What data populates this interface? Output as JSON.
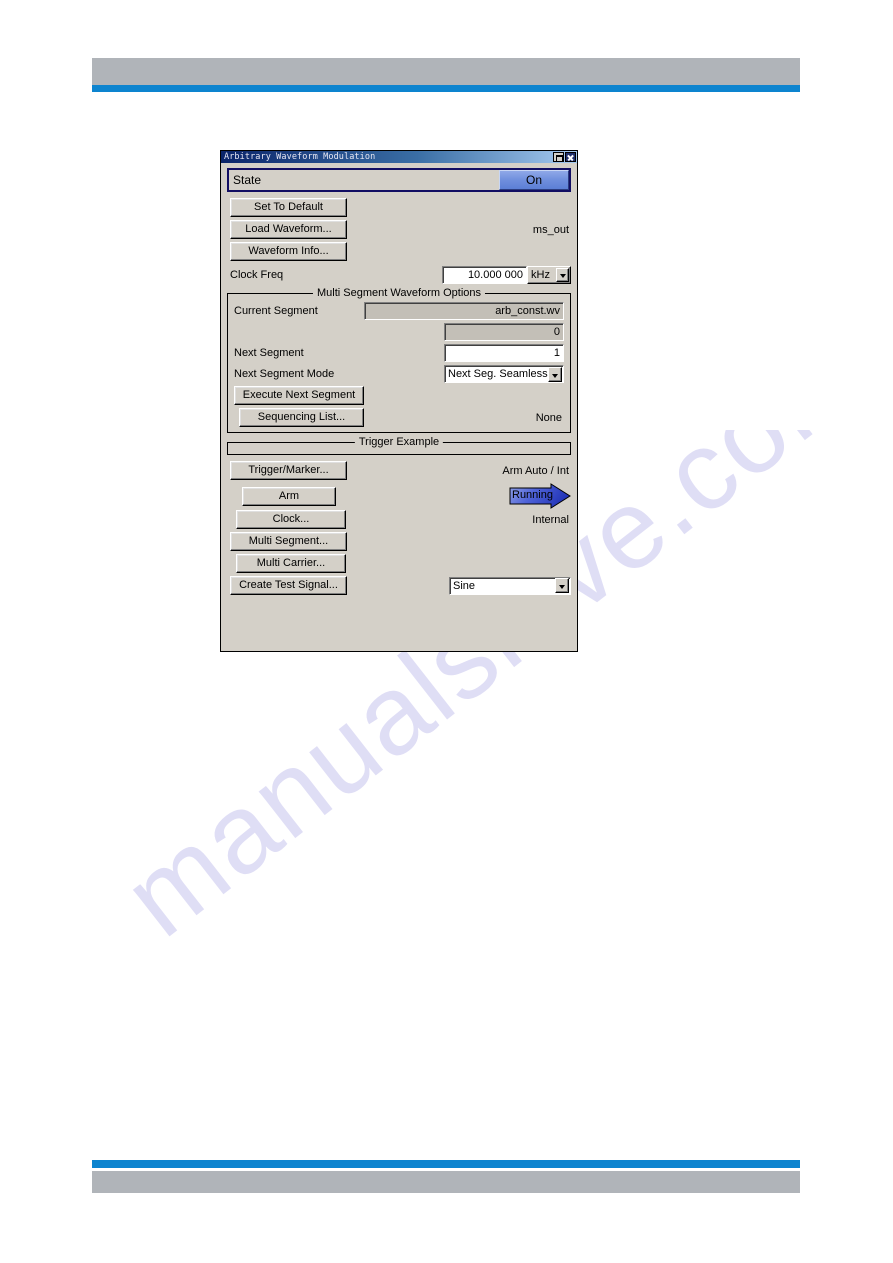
{
  "watermark": {
    "text": "manualshive.com"
  },
  "dialog": {
    "title": "Arbitrary Waveform Modulation",
    "window_buttons": [
      {
        "name": "restore-button",
        "icon": "restore-icon"
      },
      {
        "name": "close-button",
        "icon": "close-icon"
      }
    ],
    "state": {
      "label": "State",
      "value": "On"
    },
    "top_buttons": [
      {
        "label": "Set To Default"
      },
      {
        "label": "Load Waveform..."
      },
      {
        "label": "Waveform Info..."
      }
    ],
    "waveform_name": "ms_out",
    "clock_freq": {
      "label": "Clock Freq",
      "value": "10.000 000",
      "unit": "kHz"
    },
    "multi_segment": {
      "title": "Multi Segment Waveform Options",
      "current_segment_label": "Current Segment",
      "current_segment_file": "arb_const.wv",
      "current_segment_index": "0",
      "next_segment_label": "Next Segment",
      "next_segment_value": "1",
      "next_segment_mode_label": "Next Segment Mode",
      "next_segment_mode_value": "Next Seg. Seamless",
      "execute_next_segment_label": "Execute Next Segment",
      "sequencing_list_label": "Sequencing List...",
      "sequencing_list_value": "None"
    },
    "trigger_example": {
      "title": "Trigger Example"
    },
    "bottom_buttons": [
      {
        "label": "Trigger/Marker..."
      },
      {
        "label": "Arm"
      },
      {
        "label": "Clock..."
      },
      {
        "label": "Multi Segment..."
      },
      {
        "label": "Multi Carrier..."
      },
      {
        "label": "Create Test Signal..."
      }
    ],
    "trigger_mode_readout": "Arm Auto / Int",
    "running_status": "Running",
    "clock_source_readout": "Internal",
    "test_signal_type": "Sine"
  },
  "colors": {
    "header_gray": "#b0b4b9",
    "header_blue": "#0d84cf",
    "dialog_face": "#d4d0c8",
    "state_accent": "#6f8fdd",
    "focus_border": "#120e63",
    "watermark": "#cdcaf0"
  }
}
